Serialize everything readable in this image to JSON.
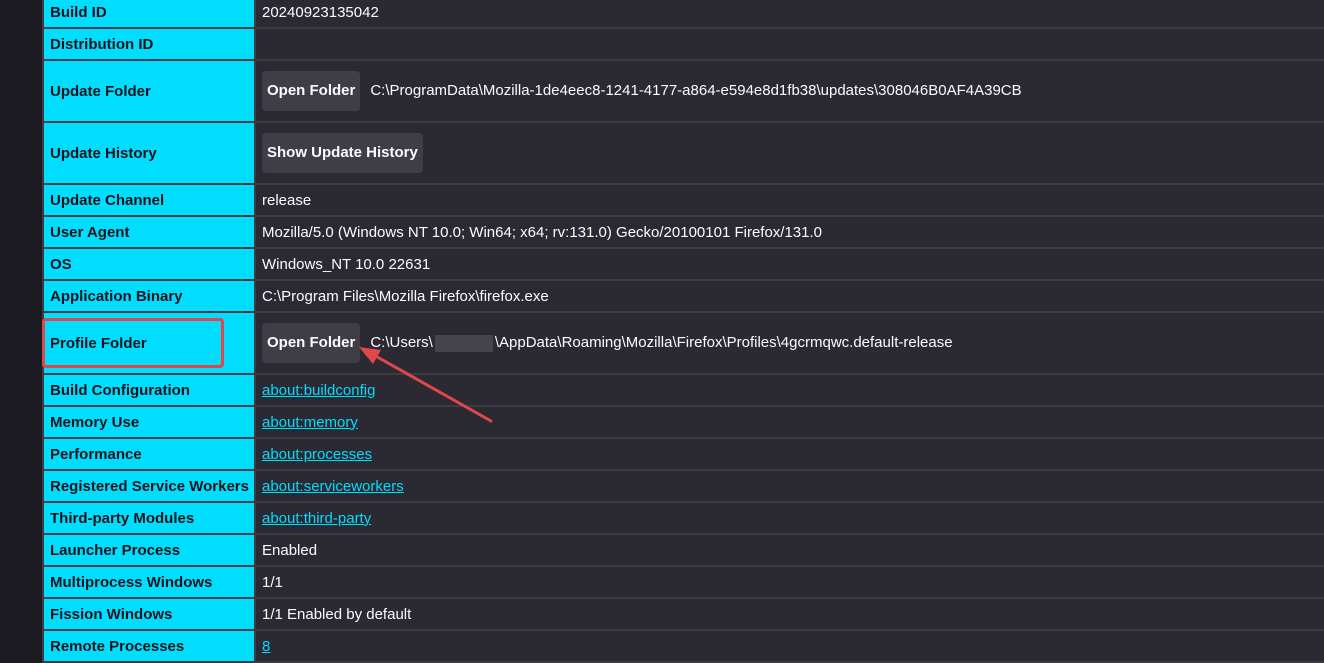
{
  "annotation_color": "#e0474c",
  "rows": {
    "build_id": {
      "label": "Build ID",
      "value": "20240923135042"
    },
    "distribution_id": {
      "label": "Distribution ID",
      "value": ""
    },
    "update_folder": {
      "label": "Update Folder",
      "button": "Open Folder",
      "value": "C:\\ProgramData\\Mozilla-1de4eec8-1241-4177-a864-e594e8d1fb38\\updates\\308046B0AF4A39CB"
    },
    "update_history": {
      "label": "Update History",
      "button": "Show Update History"
    },
    "update_channel": {
      "label": "Update Channel",
      "value": "release"
    },
    "user_agent": {
      "label": "User Agent",
      "value": "Mozilla/5.0 (Windows NT 10.0; Win64; x64; rv:131.0) Gecko/20100101 Firefox/131.0"
    },
    "os": {
      "label": "OS",
      "value": "Windows_NT 10.0 22631"
    },
    "application_binary": {
      "label": "Application Binary",
      "value": "C:\\Program Files\\Mozilla Firefox\\firefox.exe"
    },
    "profile_folder": {
      "label": "Profile Folder",
      "button": "Open Folder",
      "value_prefix": "C:\\Users\\",
      "value_suffix": "\\AppData\\Roaming\\Mozilla\\Firefox\\Profiles\\4gcrmqwc.default-release"
    },
    "build_configuration": {
      "label": "Build Configuration",
      "link": "about:buildconfig"
    },
    "memory_use": {
      "label": "Memory Use",
      "link": "about:memory"
    },
    "performance": {
      "label": "Performance",
      "link": "about:processes"
    },
    "registered_service_workers": {
      "label": "Registered Service Workers",
      "link": "about:serviceworkers"
    },
    "third_party_modules": {
      "label": "Third-party Modules",
      "link": "about:third-party"
    },
    "launcher_process": {
      "label": "Launcher Process",
      "value": "Enabled"
    },
    "multiprocess_windows": {
      "label": "Multiprocess Windows",
      "value": "1/1"
    },
    "fission_windows": {
      "label": "Fission Windows",
      "value": "1/1 Enabled by default"
    },
    "remote_processes": {
      "label": "Remote Processes",
      "link": "8"
    }
  }
}
